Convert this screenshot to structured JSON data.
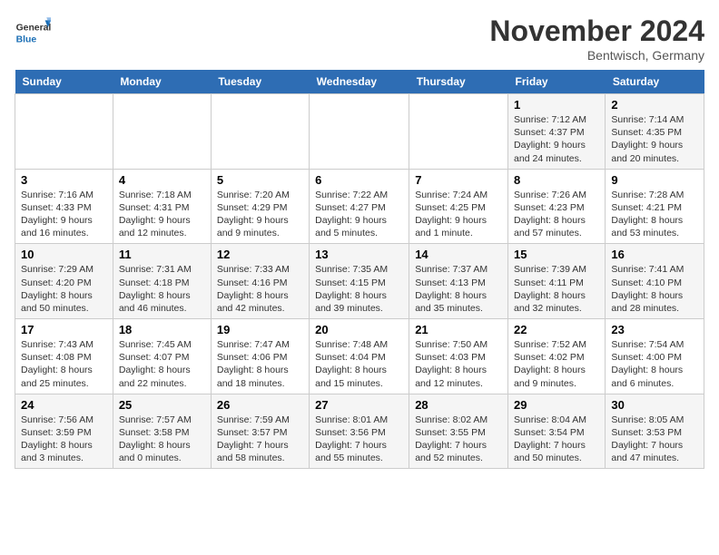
{
  "header": {
    "logo_general": "General",
    "logo_blue": "Blue",
    "month_title": "November 2024",
    "location": "Bentwisch, Germany"
  },
  "weekdays": [
    "Sunday",
    "Monday",
    "Tuesday",
    "Wednesday",
    "Thursday",
    "Friday",
    "Saturday"
  ],
  "weeks": [
    [
      {
        "day": "",
        "info": ""
      },
      {
        "day": "",
        "info": ""
      },
      {
        "day": "",
        "info": ""
      },
      {
        "day": "",
        "info": ""
      },
      {
        "day": "",
        "info": ""
      },
      {
        "day": "1",
        "info": "Sunrise: 7:12 AM\nSunset: 4:37 PM\nDaylight: 9 hours\nand 24 minutes."
      },
      {
        "day": "2",
        "info": "Sunrise: 7:14 AM\nSunset: 4:35 PM\nDaylight: 9 hours\nand 20 minutes."
      }
    ],
    [
      {
        "day": "3",
        "info": "Sunrise: 7:16 AM\nSunset: 4:33 PM\nDaylight: 9 hours\nand 16 minutes."
      },
      {
        "day": "4",
        "info": "Sunrise: 7:18 AM\nSunset: 4:31 PM\nDaylight: 9 hours\nand 12 minutes."
      },
      {
        "day": "5",
        "info": "Sunrise: 7:20 AM\nSunset: 4:29 PM\nDaylight: 9 hours\nand 9 minutes."
      },
      {
        "day": "6",
        "info": "Sunrise: 7:22 AM\nSunset: 4:27 PM\nDaylight: 9 hours\nand 5 minutes."
      },
      {
        "day": "7",
        "info": "Sunrise: 7:24 AM\nSunset: 4:25 PM\nDaylight: 9 hours\nand 1 minute."
      },
      {
        "day": "8",
        "info": "Sunrise: 7:26 AM\nSunset: 4:23 PM\nDaylight: 8 hours\nand 57 minutes."
      },
      {
        "day": "9",
        "info": "Sunrise: 7:28 AM\nSunset: 4:21 PM\nDaylight: 8 hours\nand 53 minutes."
      }
    ],
    [
      {
        "day": "10",
        "info": "Sunrise: 7:29 AM\nSunset: 4:20 PM\nDaylight: 8 hours\nand 50 minutes."
      },
      {
        "day": "11",
        "info": "Sunrise: 7:31 AM\nSunset: 4:18 PM\nDaylight: 8 hours\nand 46 minutes."
      },
      {
        "day": "12",
        "info": "Sunrise: 7:33 AM\nSunset: 4:16 PM\nDaylight: 8 hours\nand 42 minutes."
      },
      {
        "day": "13",
        "info": "Sunrise: 7:35 AM\nSunset: 4:15 PM\nDaylight: 8 hours\nand 39 minutes."
      },
      {
        "day": "14",
        "info": "Sunrise: 7:37 AM\nSunset: 4:13 PM\nDaylight: 8 hours\nand 35 minutes."
      },
      {
        "day": "15",
        "info": "Sunrise: 7:39 AM\nSunset: 4:11 PM\nDaylight: 8 hours\nand 32 minutes."
      },
      {
        "day": "16",
        "info": "Sunrise: 7:41 AM\nSunset: 4:10 PM\nDaylight: 8 hours\nand 28 minutes."
      }
    ],
    [
      {
        "day": "17",
        "info": "Sunrise: 7:43 AM\nSunset: 4:08 PM\nDaylight: 8 hours\nand 25 minutes."
      },
      {
        "day": "18",
        "info": "Sunrise: 7:45 AM\nSunset: 4:07 PM\nDaylight: 8 hours\nand 22 minutes."
      },
      {
        "day": "19",
        "info": "Sunrise: 7:47 AM\nSunset: 4:06 PM\nDaylight: 8 hours\nand 18 minutes."
      },
      {
        "day": "20",
        "info": "Sunrise: 7:48 AM\nSunset: 4:04 PM\nDaylight: 8 hours\nand 15 minutes."
      },
      {
        "day": "21",
        "info": "Sunrise: 7:50 AM\nSunset: 4:03 PM\nDaylight: 8 hours\nand 12 minutes."
      },
      {
        "day": "22",
        "info": "Sunrise: 7:52 AM\nSunset: 4:02 PM\nDaylight: 8 hours\nand 9 minutes."
      },
      {
        "day": "23",
        "info": "Sunrise: 7:54 AM\nSunset: 4:00 PM\nDaylight: 8 hours\nand 6 minutes."
      }
    ],
    [
      {
        "day": "24",
        "info": "Sunrise: 7:56 AM\nSunset: 3:59 PM\nDaylight: 8 hours\nand 3 minutes."
      },
      {
        "day": "25",
        "info": "Sunrise: 7:57 AM\nSunset: 3:58 PM\nDaylight: 8 hours\nand 0 minutes."
      },
      {
        "day": "26",
        "info": "Sunrise: 7:59 AM\nSunset: 3:57 PM\nDaylight: 7 hours\nand 58 minutes."
      },
      {
        "day": "27",
        "info": "Sunrise: 8:01 AM\nSunset: 3:56 PM\nDaylight: 7 hours\nand 55 minutes."
      },
      {
        "day": "28",
        "info": "Sunrise: 8:02 AM\nSunset: 3:55 PM\nDaylight: 7 hours\nand 52 minutes."
      },
      {
        "day": "29",
        "info": "Sunrise: 8:04 AM\nSunset: 3:54 PM\nDaylight: 7 hours\nand 50 minutes."
      },
      {
        "day": "30",
        "info": "Sunrise: 8:05 AM\nSunset: 3:53 PM\nDaylight: 7 hours\nand 47 minutes."
      }
    ]
  ]
}
